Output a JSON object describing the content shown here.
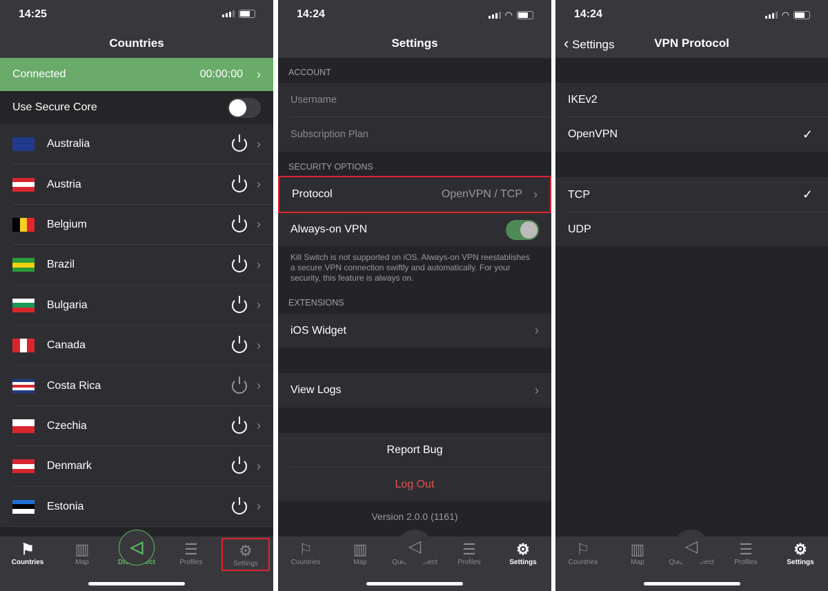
{
  "panel1": {
    "time": "14:25",
    "title": "Countries",
    "connected": "Connected",
    "timer": "00:00:00",
    "secure_core": "Use Secure Core",
    "secure_core_on": false,
    "countries": [
      {
        "name": "Australia",
        "flag": [
          "#1f3a8a",
          "#1f3a8a",
          "#1f3a8a"
        ]
      },
      {
        "name": "Austria",
        "flag": [
          "#d8262e",
          "#ffffff",
          "#d8262e"
        ]
      },
      {
        "name": "Belgium",
        "flag": [
          "vertical",
          "#000000",
          "#f5d020",
          "#e3252d"
        ]
      },
      {
        "name": "Brazil",
        "flag": [
          "#2a9a3a",
          "#f2d10e",
          "#2a9a3a"
        ]
      },
      {
        "name": "Bulgaria",
        "flag": [
          "#ffffff",
          "#1a9a5a",
          "#d8262e"
        ]
      },
      {
        "name": "Canada",
        "flag": [
          "vertical",
          "#d8262e",
          "#ffffff",
          "#d8262e"
        ]
      },
      {
        "name": "Costa Rica",
        "flag": [
          "#1f3a8a",
          "#ffffff",
          "#d8262e",
          "#ffffff",
          "#1f3a8a"
        ]
      },
      {
        "name": "Czechia",
        "flag": [
          "#ffffff",
          "#d8262e"
        ]
      },
      {
        "name": "Denmark",
        "flag": [
          "#d8262e",
          "#ffffff",
          "#d8262e"
        ]
      },
      {
        "name": "Estonia",
        "flag": [
          "#1f6fd0",
          "#000000",
          "#ffffff"
        ]
      }
    ]
  },
  "panel2": {
    "time": "14:24",
    "title": "Settings",
    "account_header": "ACCOUNT",
    "username": "Username",
    "subscription": "Subscription Plan",
    "security_header": "SECURITY OPTIONS",
    "protocol_label": "Protocol",
    "protocol_value": "OpenVPN / TCP",
    "always_on": "Always-on VPN",
    "always_on_enabled": true,
    "footnote": "Kill Switch is not supported on iOS. Always-on VPN reestablishes a secure VPN connection swiftly and automatically. For your security, this feature is always on.",
    "extensions_header": "EXTENSIONS",
    "ios_widget": "iOS Widget",
    "view_logs": "View Logs",
    "report_bug": "Report Bug",
    "log_out": "Log Out",
    "version": "Version 2.0.0 (1161)"
  },
  "panel3": {
    "time": "14:24",
    "back": "Settings",
    "title": "VPN Protocol",
    "protocols": [
      "IKEv2",
      "OpenVPN"
    ],
    "selected_protocol": "OpenVPN",
    "transports": [
      "TCP",
      "UDP"
    ],
    "selected_transport": "TCP"
  },
  "tabs1": [
    "Countries",
    "Map",
    "Disconnect",
    "Profiles",
    "Settings"
  ],
  "tabs": [
    "Countries",
    "Map",
    "Quick Connect",
    "Profiles",
    "Settings"
  ],
  "colors": {
    "connected_green": "#6aaa6a",
    "accent_green": "#5fb85f",
    "highlight_red": "#e0222e",
    "logout_red": "#e05050"
  }
}
